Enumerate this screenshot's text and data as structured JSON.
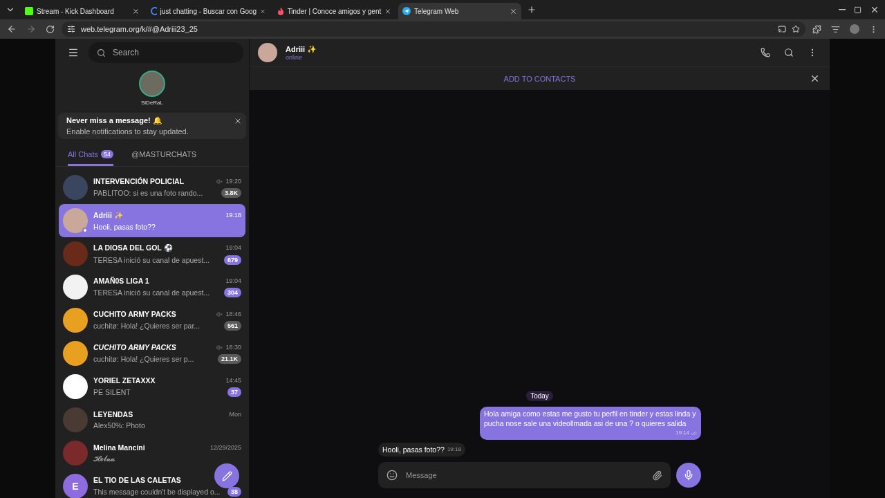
{
  "browser": {
    "tabs": [
      {
        "title": "Stream - Kick Dashboard",
        "selected": false
      },
      {
        "title": "just chatting - Buscar con Goog",
        "selected": false
      },
      {
        "title": "Tinder | Conoce amigos y gent",
        "selected": false
      },
      {
        "title": "Telegram Web",
        "selected": true
      }
    ],
    "url": "web.telegram.org/k/#@Adriii23_25"
  },
  "sidebar": {
    "search": {
      "placeholder": "Search"
    },
    "profile": {
      "name": "SiDeRaL"
    },
    "notice": {
      "title": "Never miss a message! 🔔",
      "text": "Enable notifications to stay updated."
    },
    "folders": [
      {
        "label": "All Chats",
        "count": "54",
        "selected": true
      },
      {
        "label": "@MASTURCHATS",
        "selected": false
      }
    ],
    "chats": [
      {
        "name": "INTERVENCIÓN POLICIAL",
        "time": "19:20",
        "preview": "PABLITOO: si es una foto rando...",
        "badge": "3.8K",
        "muted": true,
        "selected": false
      },
      {
        "name": "Adriii ✨",
        "time": "19:18",
        "preview": "Hooli, pasas foto??",
        "muted": false,
        "selected": true,
        "online": true
      },
      {
        "name": "LA DIOSA DEL GOL ⚽",
        "time": "19:04",
        "preview": "TERESA inició su canal de apuest...",
        "badge": "679",
        "muted": false,
        "selected": false
      },
      {
        "name": "AMAÑ0S LIGA 1",
        "time": "19:04",
        "preview": "TERESA inició su canal de apuest...",
        "badge": "304",
        "muted": false,
        "selected": false
      },
      {
        "name": "CUCHITO ARMY PACKS",
        "time": "18:46",
        "preview": "cuchitø: Hola! ¿Quieres ser par...",
        "badge": "561",
        "muted": true,
        "selected": false
      },
      {
        "name": "CUCHITO ARMY PACKS",
        "time": "18:30",
        "preview": "cuchitø: Hola! ¿Quieres ser p...",
        "badge": "21.1K",
        "muted": true,
        "selected": false,
        "italic": true
      },
      {
        "name": "YORIEL ZETAXXX",
        "time": "14:45",
        "preview": "PE SILENT",
        "badge": "37",
        "muted": false,
        "selected": false
      },
      {
        "name": "LEYENDAS",
        "time": "Mon",
        "preview": "Alex50%: Photo",
        "muted": false,
        "selected": false
      },
      {
        "name": "Melina Mancini",
        "time": "12/29/2025",
        "preview": "𝓗𝓸𝓵𝓪𝓪",
        "muted": false,
        "selected": false
      },
      {
        "name": "EL TIO DE LAS CALETAS",
        "preview": "This message couldn't be displayed o...",
        "badge": "38",
        "muted": false,
        "selected": false,
        "initial": "E"
      }
    ]
  },
  "chat": {
    "name": "Adriii ✨",
    "status": "online",
    "banner": "ADD TO CONTACTS",
    "date": "Today",
    "messages": [
      {
        "text": "Hola amiga como estas me gusto tu perfil en tinder y estas linda y pucha nose sale una videollmada asi de una ? o quieres salida",
        "time": "19:14",
        "outgoing": true,
        "read": true
      },
      {
        "text": "Hooli, pasas foto??",
        "time": "19:18",
        "outgoing": false
      }
    ],
    "composer": {
      "placeholder": "Message"
    }
  }
}
